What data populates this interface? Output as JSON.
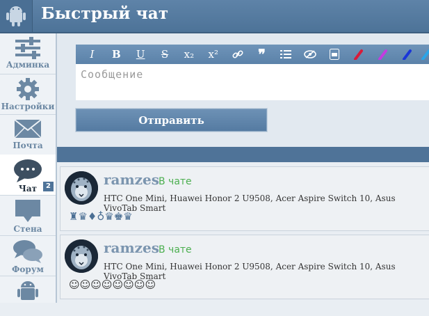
{
  "header": {
    "title": "Быстрый чат",
    "logo_icon": "android-icon"
  },
  "sidebar": {
    "items": [
      {
        "label": "Админка",
        "icon": "sliders-icon"
      },
      {
        "label": "Настройки",
        "icon": "gear-icon"
      },
      {
        "label": "Почта",
        "icon": "envelope-icon"
      },
      {
        "label": "Чат",
        "icon": "chat-bubble-icon",
        "active": true,
        "badge": "2"
      },
      {
        "label": "Стена",
        "icon": "wall-icon"
      },
      {
        "label": "Форум",
        "icon": "forum-icon"
      },
      {
        "label": "",
        "icon": "android-icon"
      }
    ]
  },
  "toolbar": {
    "buttons": [
      "I",
      "B",
      "U",
      "S",
      "x₂",
      "x²",
      "🔗",
      "❞",
      "☰",
      "◐",
      "▣",
      "●",
      "●",
      "●",
      "●"
    ]
  },
  "composer": {
    "placeholder": "Сообщение",
    "send_label": "Отправить"
  },
  "messages": [
    {
      "name": "ramzes",
      "status": "В чате",
      "devices": "HTC One Mini, Huawei Honor 2 U9508, Acer Aspire Switch 10, Asus VivoTab Smart",
      "badges": "♜♛♦♁♛♚♛"
    },
    {
      "name": "ramzes",
      "status": "В чате",
      "devices": "HTC One Mini, Huawei Honor 2 U9508, Acer Aspire Switch 10, Asus VivoTab Smart",
      "emoji": "☺☺☺☺☺☺☺☺"
    }
  ],
  "colors": {
    "header": "#5479a0",
    "accent": "#4f7398",
    "online": "#4caf50"
  }
}
